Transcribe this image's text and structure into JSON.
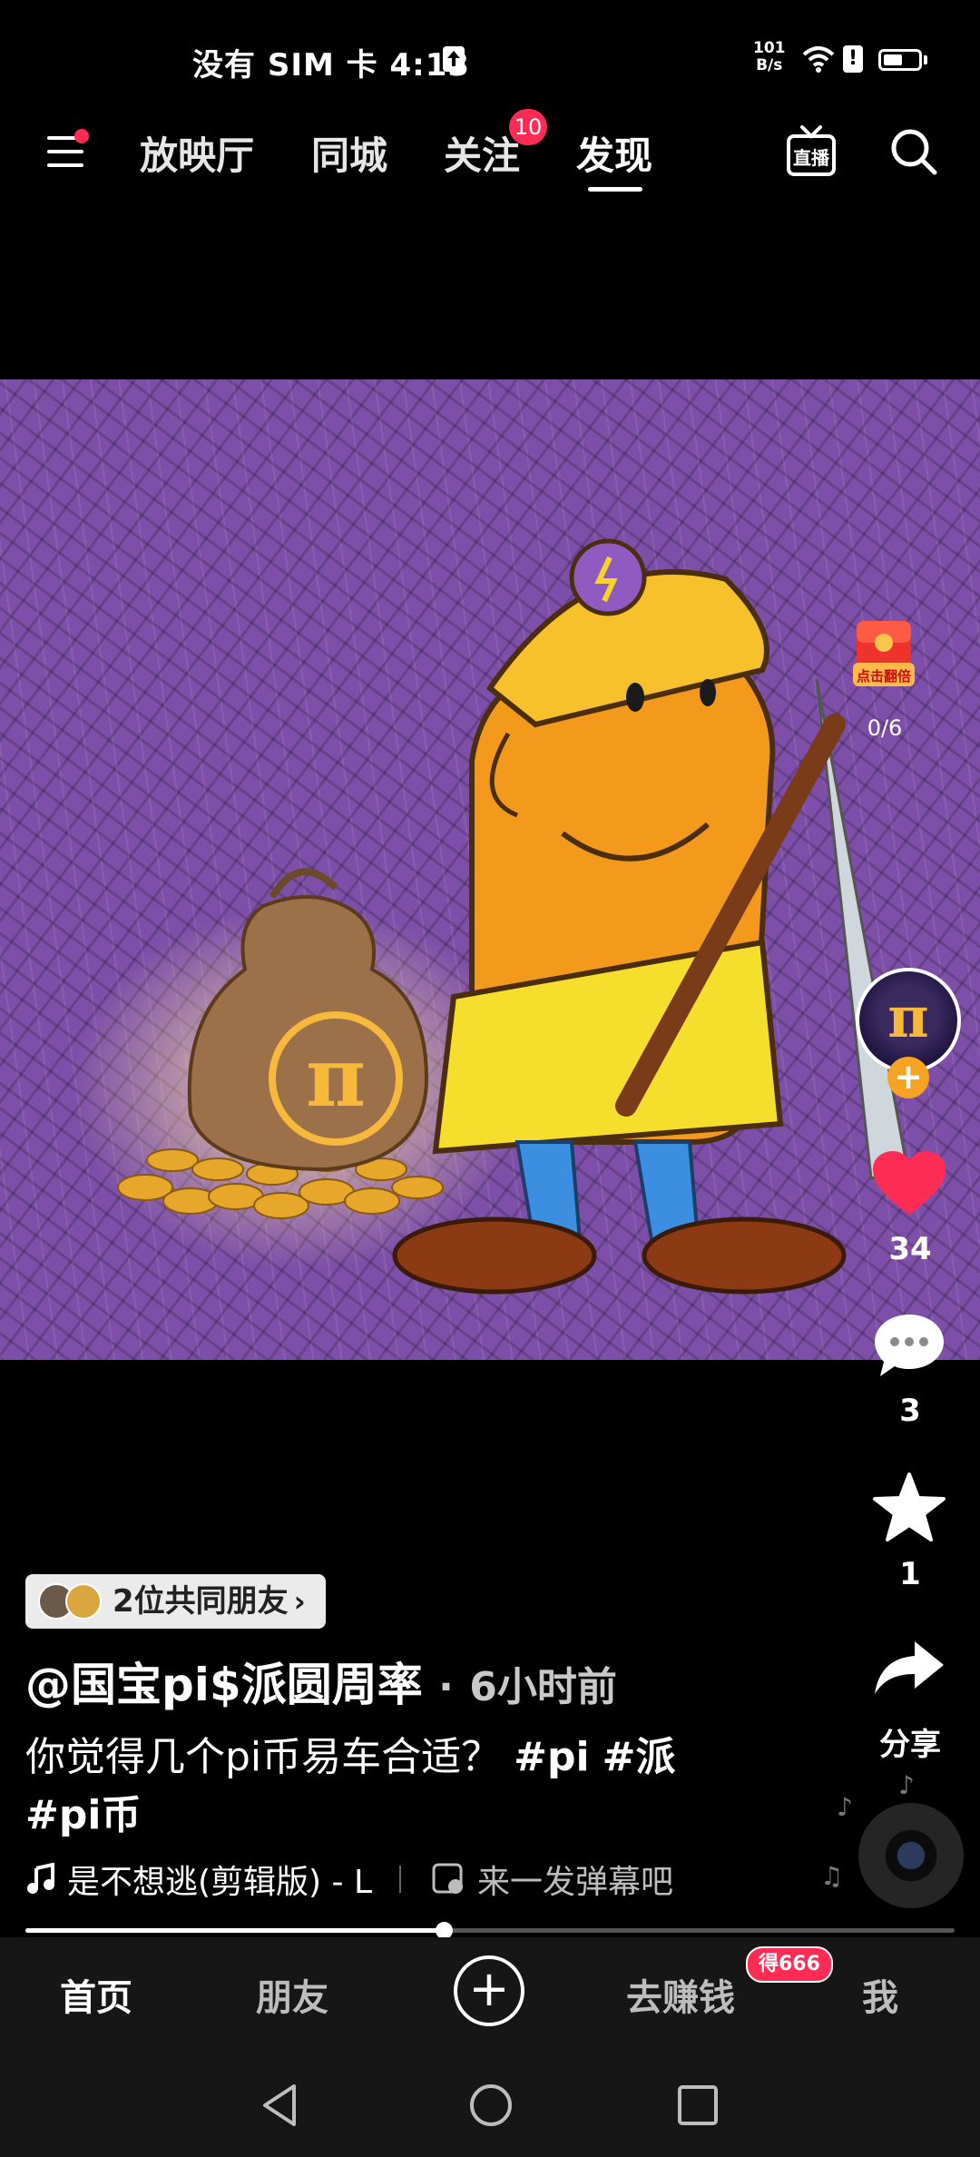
{
  "status_bar": {
    "carrier_time": "没有 SIM 卡 4:13",
    "net_rate_top": "101",
    "net_rate_bottom": "B/s"
  },
  "top_nav": {
    "tabs": [
      {
        "label": "放映厅"
      },
      {
        "label": "同城"
      },
      {
        "label": "关注"
      },
      {
        "label": "发现"
      }
    ],
    "active_tab": "发现",
    "follow_badge": "10",
    "live_label": "直播"
  },
  "video": {
    "red_packet_label": "点击翻倍",
    "red_packet_progress": "0/6",
    "avatar_text": "π"
  },
  "actions": {
    "likes": "34",
    "comments": "3",
    "favorites": "1",
    "share_label": "分享"
  },
  "post": {
    "mutual_friends": "2位共同朋友",
    "author": "@国宝pi$派圆周率",
    "time_separator": "·",
    "time": "6小时前",
    "caption_text": "你觉得几个pi币易车合适？ ",
    "hashtags": [
      "#pi",
      "#派",
      "#pi币"
    ],
    "music": "是不想逃(剪辑版) - L",
    "danmu_placeholder": "来一发弹幕吧",
    "progress": 0.45
  },
  "bottom_tabs": {
    "home": "首页",
    "friends": "朋友",
    "earn": "去赚钱",
    "earn_badge": "得666",
    "me": "我"
  },
  "colors": {
    "accent": "#fe2c55",
    "video_bg": "#7e4fa8",
    "like_red": "#fe2c55"
  }
}
